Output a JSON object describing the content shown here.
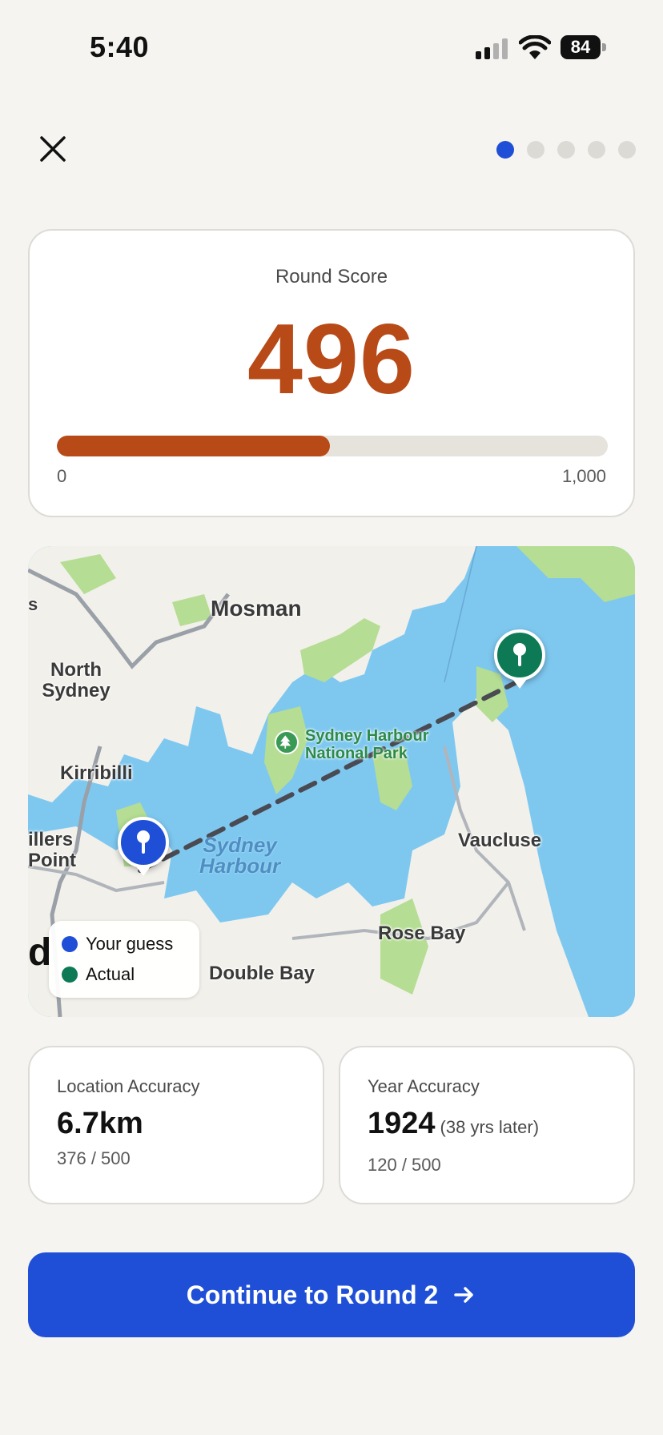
{
  "status_bar": {
    "time": "5:40",
    "battery": "84"
  },
  "progress": {
    "total_rounds": 5,
    "current_round": 1
  },
  "score": {
    "label": "Round Score",
    "value": "496",
    "fraction": 0.496,
    "min_label": "0",
    "max_label": "1,000"
  },
  "map": {
    "places": {
      "mosman": "Mosman",
      "north_sydney": "North\nSydney",
      "kirribilli": "Kirribilli",
      "millers_point": "illers\nPoint",
      "vaucluse": "Vaucluse",
      "rose_bay": "Rose Bay",
      "double_bay": "Double Bay",
      "s_edge": "s"
    },
    "park": "Sydney Harbour\nNational Park",
    "water": "Sydney\nHarbour",
    "legend": {
      "guess": "Your guess",
      "actual": "Actual"
    },
    "edge_letter": "d",
    "colors": {
      "guess": "#1f4fd6",
      "actual": "#0d7a55",
      "water": "#7ec8f0",
      "land": "#f2f0ea",
      "park": "#b5dd93"
    }
  },
  "location_accuracy": {
    "label": "Location Accuracy",
    "value": "6.7km",
    "points": "376 / 500"
  },
  "year_accuracy": {
    "label": "Year Accuracy",
    "value": "1924",
    "extra": "(38 yrs later)",
    "points": "120 / 500"
  },
  "continue_button": {
    "label": "Continue to Round 2"
  }
}
